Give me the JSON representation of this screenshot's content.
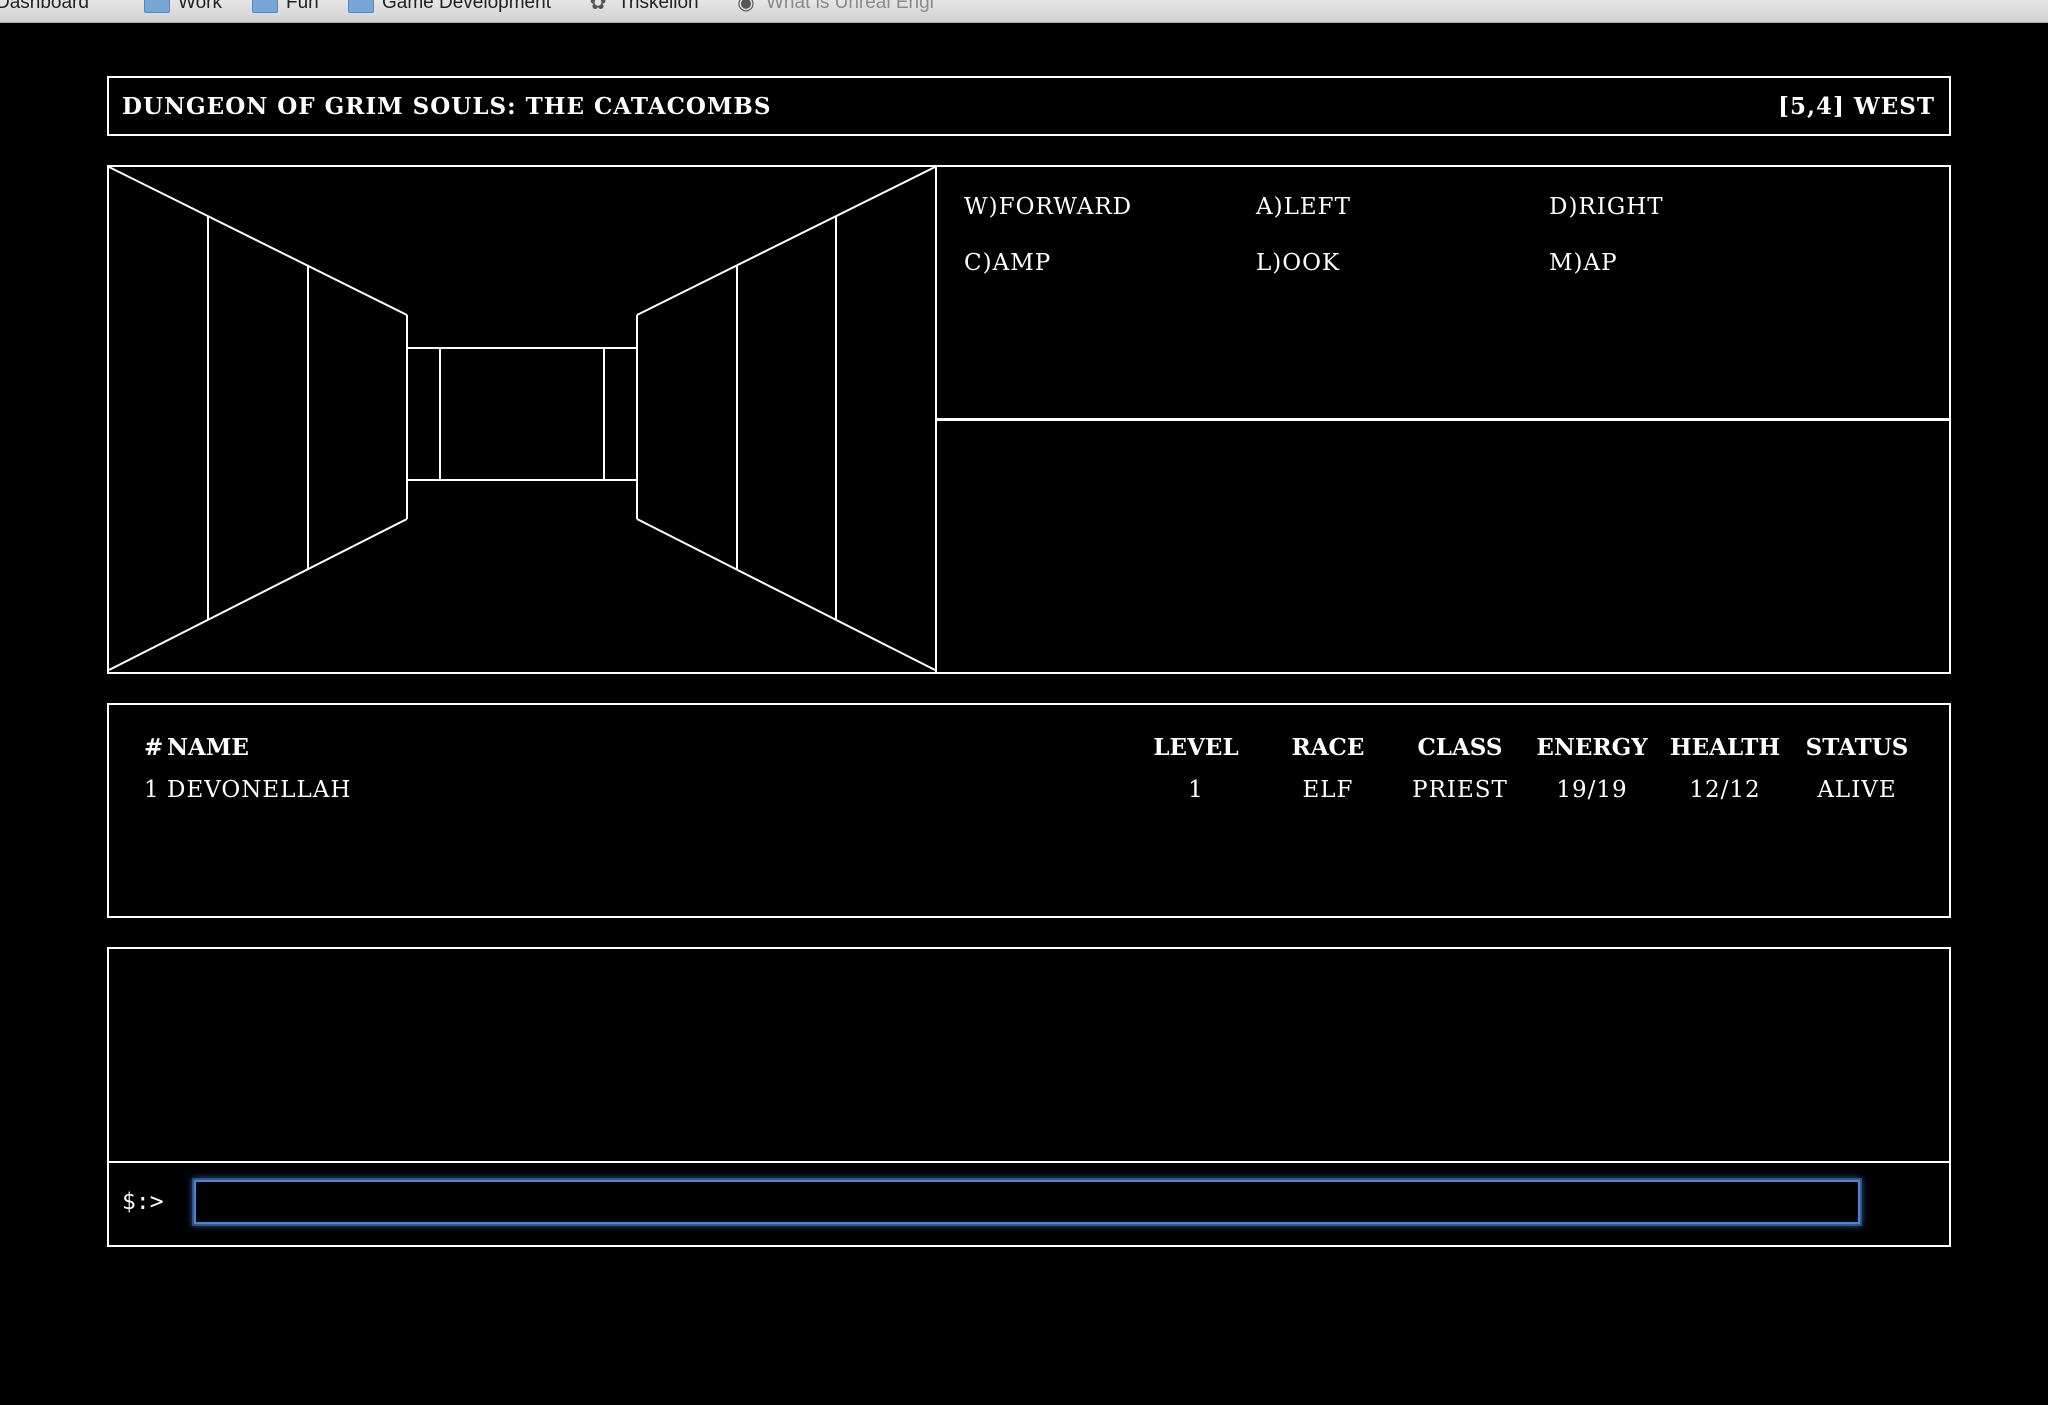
{
  "bookmarks": [
    {
      "label": "Dashboard",
      "icon": "folder-icon"
    },
    {
      "label": "Work",
      "icon": "folder-icon"
    },
    {
      "label": "Fun",
      "icon": "folder-icon"
    },
    {
      "label": "Game Development",
      "icon": "folder-icon"
    },
    {
      "label": "Triskelion",
      "icon": "triskelion-icon"
    },
    {
      "label": "What is Unreal Engi",
      "icon": "unreal-logo-icon"
    }
  ],
  "game": {
    "title": "DUNGEON OF GRIM SOULS: THE CATACOMBS",
    "position": "[5,4] WEST"
  },
  "commands": [
    {
      "key": "W)",
      "label": "FORWARD"
    },
    {
      "key": "A)",
      "label": "LEFT"
    },
    {
      "key": "D)",
      "label": "RIGHT"
    },
    {
      "key": "C)",
      "label": "AMP"
    },
    {
      "key": "L)",
      "label": "OOK"
    },
    {
      "key": "M)",
      "label": "AP"
    }
  ],
  "party": {
    "headers": {
      "num": "#",
      "name": "NAME",
      "level": "LEVEL",
      "race": "RACE",
      "class": "CLASS",
      "energy": "ENERGY",
      "health": "HEALTH",
      "status": "STATUS"
    },
    "members": [
      {
        "num": "1",
        "name": "DEVONELLAH",
        "level": "1",
        "race": "ELF",
        "class": "PRIEST",
        "energy": "19/19",
        "health": "12/12",
        "status": "ALIVE"
      }
    ]
  },
  "console": {
    "prompt": "$:>",
    "input_value": ""
  },
  "colors": {
    "background": "#000000",
    "foreground": "#ffffff",
    "input_focus": "#4a86d8"
  }
}
